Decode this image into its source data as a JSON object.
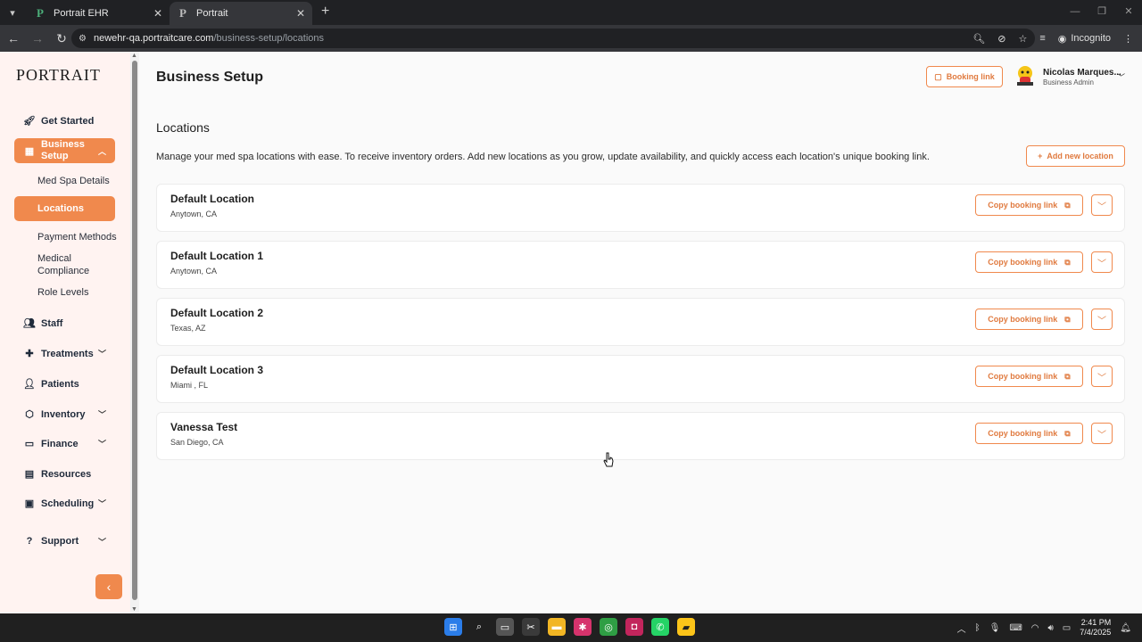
{
  "browser": {
    "tabs": [
      {
        "label": "Portrait EHR",
        "favicon": "P",
        "active": false
      },
      {
        "label": "Portrait",
        "favicon": "P",
        "active": true
      }
    ],
    "url_host": "newehr-qa.portraitcare.com",
    "url_path": "/business-setup/locations",
    "incognito_label": "Incognito"
  },
  "sidebar": {
    "logo": "PORTRAIT",
    "items": {
      "get_started": "Get Started",
      "business_setup": "Business Setup",
      "med_spa_details": "Med Spa Details",
      "locations": "Locations",
      "payment_methods": "Payment Methods",
      "medical_compliance": "Medical Compliance",
      "role_levels": "Role Levels",
      "staff": "Staff",
      "treatments": "Treatments",
      "patients": "Patients",
      "inventory": "Inventory",
      "finance": "Finance",
      "resources": "Resources",
      "scheduling": "Scheduling",
      "support": "Support"
    }
  },
  "header": {
    "title": "Business Setup",
    "booking_link_label": "Booking link",
    "user_name": "Nicolas Marques...",
    "user_role": "Business Admin"
  },
  "locations": {
    "title": "Locations",
    "description": "Manage your med spa locations with ease. To receive inventory orders. Add new locations as you grow, update availability, and quickly access each location's unique booking link.",
    "add_label": "Add new location",
    "copy_label": "Copy booking link",
    "items": [
      {
        "name": "Default Location",
        "address": "Anytown, CA"
      },
      {
        "name": "Default Location 1",
        "address": "Anytown, CA"
      },
      {
        "name": "Default Location 2",
        "address": "Texas, AZ"
      },
      {
        "name": "Default Location 3",
        "address": "Miami , FL"
      },
      {
        "name": "Vanessa Test",
        "address": "San Diego, CA"
      }
    ]
  },
  "taskbar": {
    "time": "2:41 PM",
    "date": "7/4/2025"
  },
  "colors": {
    "accent": "#f0894d",
    "sidebar_bg": "#fff3f1",
    "page_bg": "#fafafa"
  }
}
